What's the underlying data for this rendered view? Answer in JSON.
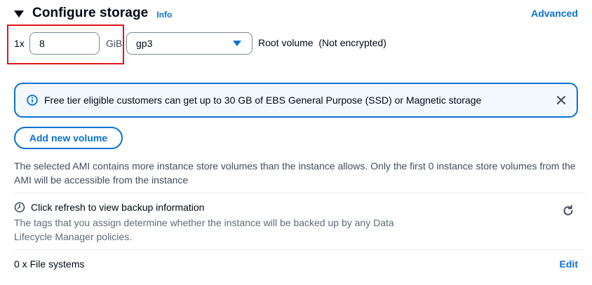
{
  "section": {
    "title": "Configure storage",
    "info_label": "Info",
    "advanced_label": "Advanced"
  },
  "volume": {
    "count_prefix": "1x",
    "size_value": "8",
    "size_unit": "GiB",
    "type_selected": "gp3",
    "root_label": "Root volume  (Not encrypted)"
  },
  "alert": {
    "icon": "info-circle-icon",
    "text": "Free tier eligible customers can get up to 30 GB of EBS General Purpose (SSD) or Magnetic storage",
    "close_icon": "close-icon"
  },
  "add_volume_label": "Add new volume",
  "ami_note": "The selected AMI contains more instance store volumes than the instance allows. Only the first 0 instance store volumes from the AMI will be accessible from the instance",
  "backup": {
    "icon": "clock-icon",
    "title": "Click refresh to view backup information",
    "description": "The tags that you assign determine whether the instance will be backed up by any Data Lifecycle Manager policies.",
    "refresh_icon": "refresh-icon"
  },
  "file_systems": {
    "label": "0 x File systems",
    "edit_label": "Edit"
  },
  "colors": {
    "accent": "#0972d3",
    "highlight": "#e0141b",
    "alert_bg": "#f2f8fd",
    "text": "#000716"
  }
}
